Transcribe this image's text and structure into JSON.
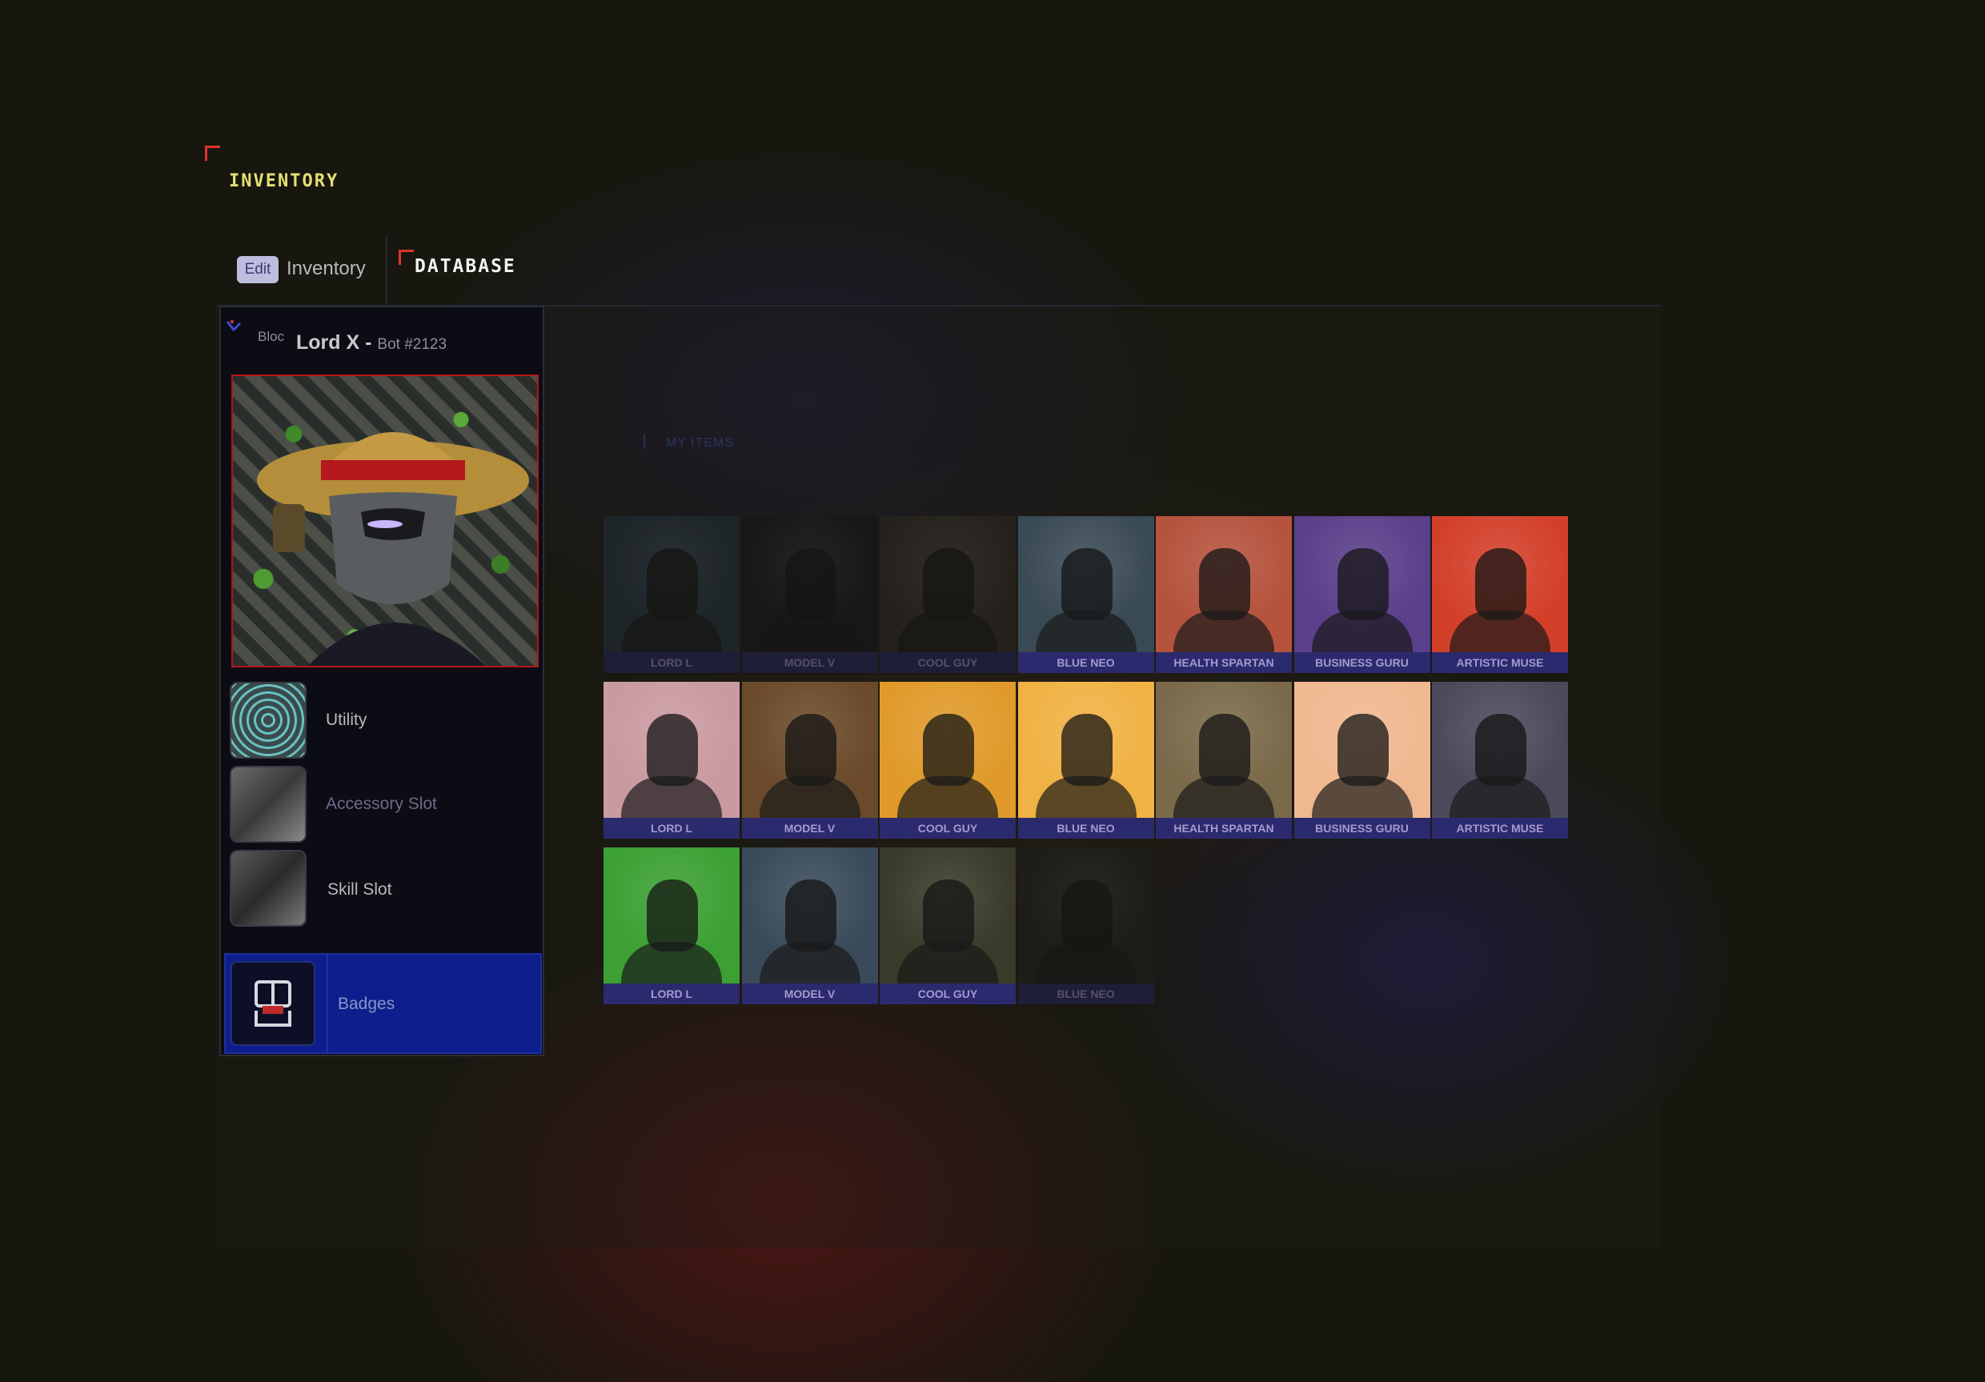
{
  "header": {
    "title": "INVENTORY"
  },
  "tabs": {
    "edit_label": "Edit",
    "inventory_label": "Inventory",
    "database_label": "DATABASE"
  },
  "bot": {
    "brand": "Bloc",
    "name": "Lord X - ",
    "id": "Bot #2123"
  },
  "slots": [
    {
      "label": "Utility",
      "color": "#b8b8bd"
    },
    {
      "label": "Accessory Slot",
      "color": "#6e6a8a"
    },
    {
      "label": "Skill Slot",
      "color": "#b8b8bd"
    }
  ],
  "badges": {
    "label": "Badges"
  },
  "items_section": {
    "label": "MY ITEMS"
  },
  "grid": [
    {
      "label": "LORD L",
      "bg": "#2a3a4a",
      "dim": true
    },
    {
      "label": "MODEL V",
      "bg": "#1e1c24",
      "dim": true
    },
    {
      "label": "COOL GUY",
      "bg": "#3b3330",
      "dim": true
    },
    {
      "label": "BLUE NEO",
      "bg": "#3a4a55",
      "dim": false
    },
    {
      "label": "HEALTH SPARTAN",
      "bg": "#b5533d",
      "dim": false
    },
    {
      "label": "BUSINESS GURU",
      "bg": "#5a3f8a",
      "dim": false
    },
    {
      "label": "ARTISTIC MUSE",
      "bg": "#d3402a",
      "dim": false
    },
    {
      "label": "LORD L",
      "bg": "#c99aa0",
      "dim": false
    },
    {
      "label": "MODEL V",
      "bg": "#6a4a2a",
      "dim": false
    },
    {
      "label": "COOL GUY",
      "bg": "#e09a2a",
      "dim": false
    },
    {
      "label": "BLUE NEO",
      "bg": "#f0b244",
      "dim": false
    },
    {
      "label": "HEALTH SPARTAN",
      "bg": "#7a6a4a",
      "dim": false
    },
    {
      "label": "BUSINESS GURU",
      "bg": "#f0b890",
      "dim": false
    },
    {
      "label": "ARTISTIC MUSE",
      "bg": "#4a4a5a",
      "dim": false
    },
    {
      "label": "LORD L",
      "bg": "#3ca033",
      "dim": false
    },
    {
      "label": "MODEL V",
      "bg": "#3a4a5a",
      "dim": false
    },
    {
      "label": "COOL GUY",
      "bg": "#3a3a2a",
      "dim": false
    },
    {
      "label": "BLUE NEO",
      "bg": "#2a2620",
      "dim": true
    }
  ]
}
